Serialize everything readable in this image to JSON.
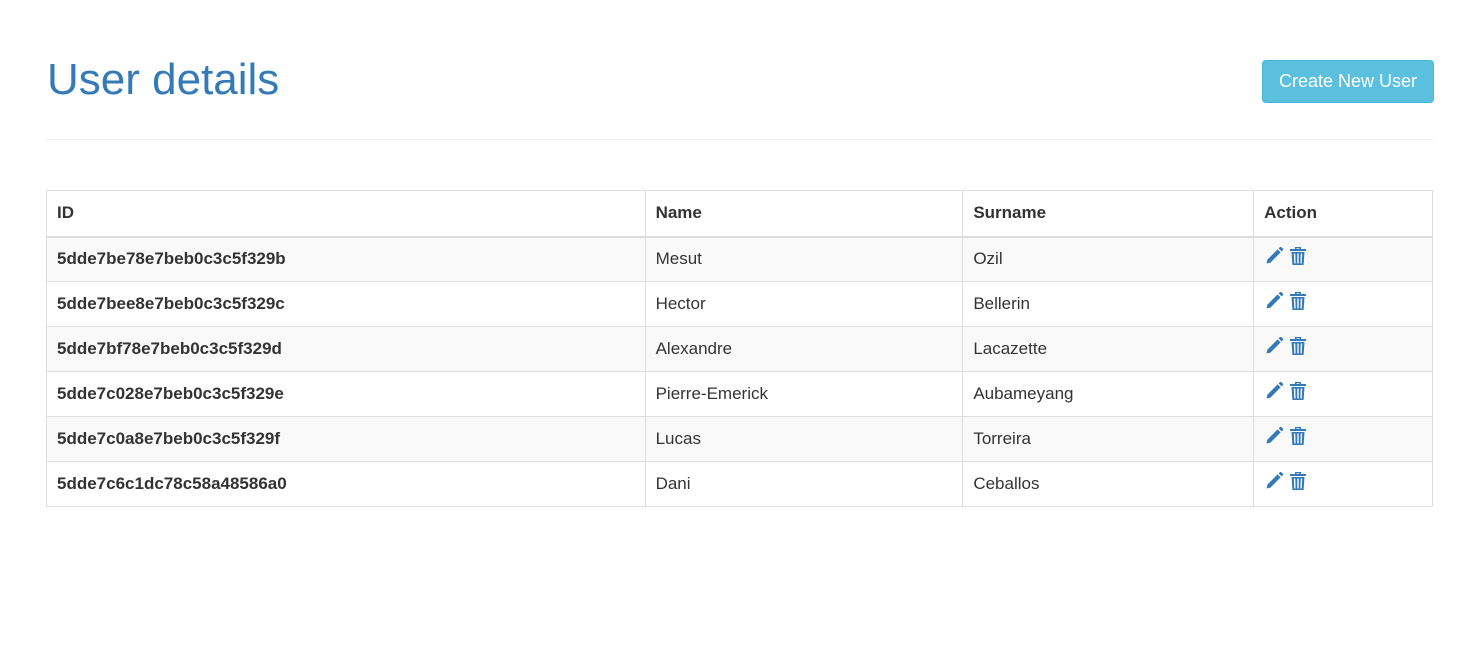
{
  "header": {
    "title": "User details",
    "create_button_label": "Create New User"
  },
  "table": {
    "columns": [
      "ID",
      "Name",
      "Surname",
      "Action"
    ],
    "rows": [
      {
        "id": "5dde7be78e7beb0c3c5f329b",
        "name": "Mesut",
        "surname": "Ozil"
      },
      {
        "id": "5dde7bee8e7beb0c3c5f329c",
        "name": "Hector",
        "surname": "Bellerin"
      },
      {
        "id": "5dde7bf78e7beb0c3c5f329d",
        "name": "Alexandre",
        "surname": "Lacazette"
      },
      {
        "id": "5dde7c028e7beb0c3c5f329e",
        "name": "Pierre-Emerick",
        "surname": "Aubameyang"
      },
      {
        "id": "5dde7c0a8e7beb0c3c5f329f",
        "name": "Lucas",
        "surname": "Torreira"
      },
      {
        "id": "5dde7c6c1dc78c58a48586a0",
        "name": "Dani",
        "surname": "Ceballos"
      }
    ],
    "row_actions": [
      {
        "icon": "pencil-icon",
        "name": "edit-user"
      },
      {
        "icon": "trash-icon",
        "name": "delete-user"
      }
    ]
  },
  "colors": {
    "title": "#337ab7",
    "button_bg": "#5bc0de",
    "icon": "#337ab7",
    "stripe": "#f9f9f9",
    "border": "#dddddd"
  }
}
